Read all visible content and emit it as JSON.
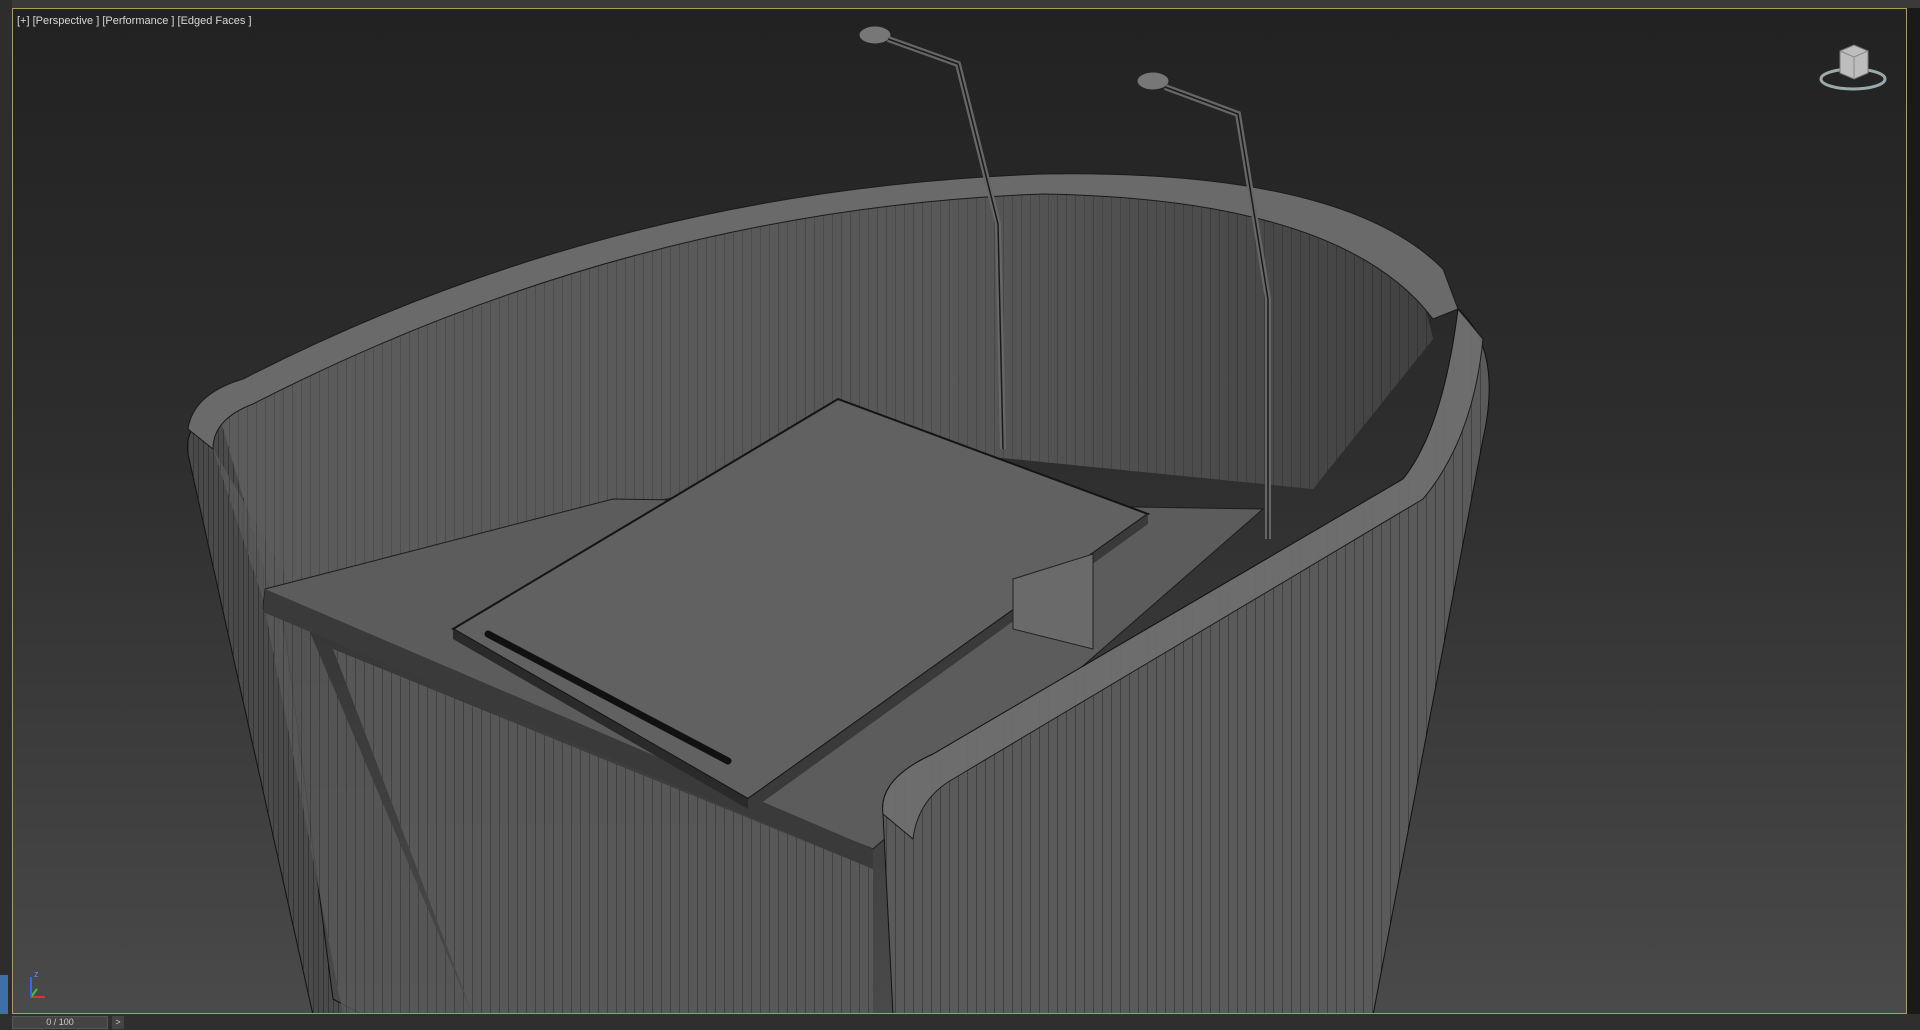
{
  "viewport": {
    "label_plus": "[+]",
    "label_view": "[Perspective ]",
    "label_shading": "[Performance ]",
    "label_edges": "[Edged Faces ]"
  },
  "viewcube": {
    "icon": "viewcube-icon"
  },
  "axis_tripod": {
    "icon": "axis-tripod-icon",
    "z_label": "z"
  },
  "time_slider": {
    "value": "0 / 100",
    "next_label": ">"
  },
  "colors": {
    "viewport_border": "#b49b45",
    "selection_accent": "#3f6fa8"
  }
}
